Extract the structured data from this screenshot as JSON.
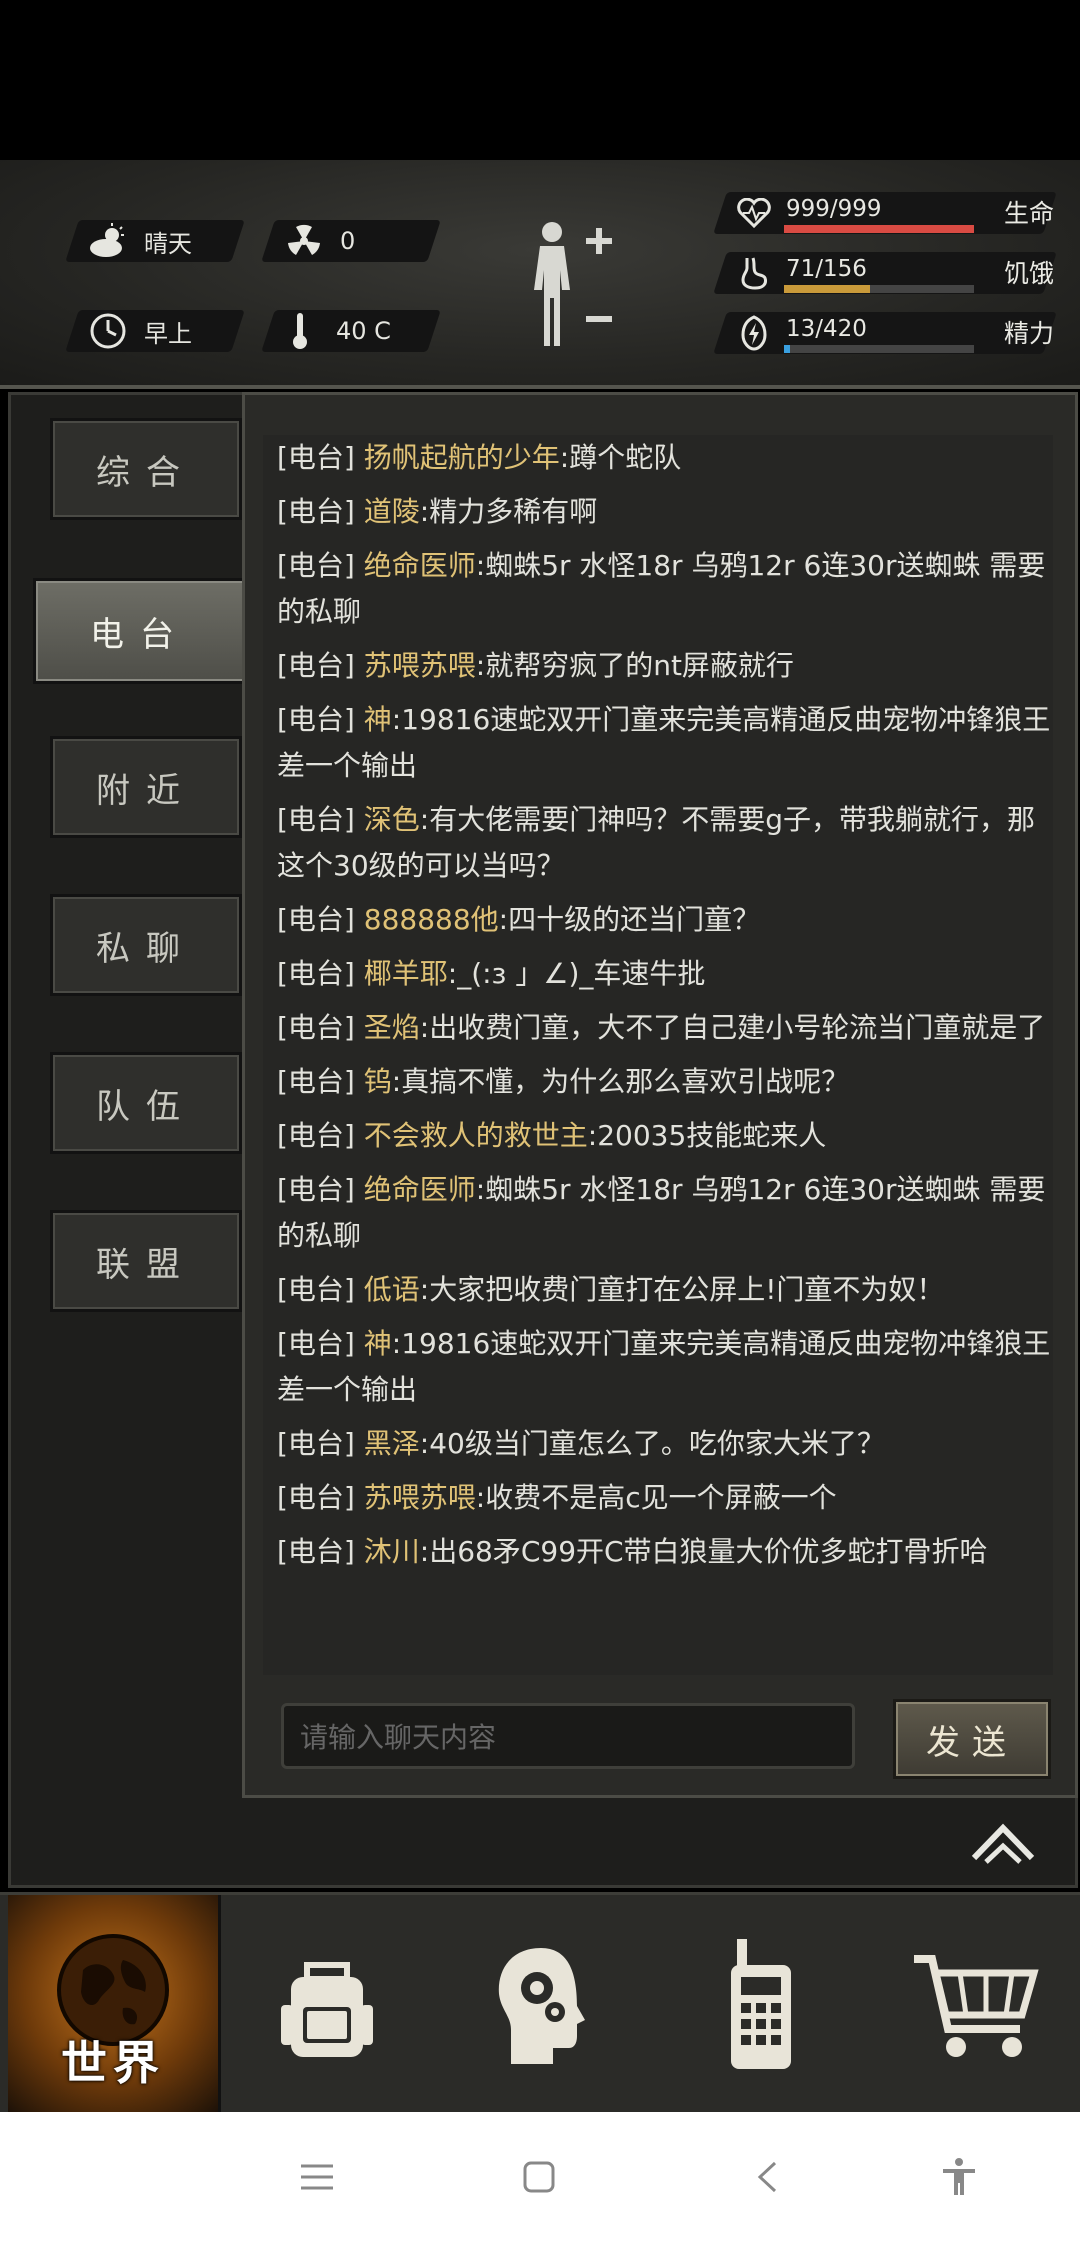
{
  "hud": {
    "weather": "晴天",
    "radiation": "0",
    "time_of_day": "早上",
    "temperature": "40 C",
    "stats": [
      {
        "icon": "heart-icon",
        "value": "999/999",
        "label": "生命",
        "fraction": 1.0,
        "color": "#d94b43"
      },
      {
        "icon": "stomach-icon",
        "value": "71/156",
        "label": "饥饿",
        "fraction": 0.455,
        "color": "#c99a3a"
      },
      {
        "icon": "energy-icon",
        "value": "13/420",
        "label": "精力",
        "fraction": 0.031,
        "color": "#3aa0e0"
      }
    ]
  },
  "tabs": [
    {
      "label": "综合"
    },
    {
      "label": "电台"
    },
    {
      "label": "附近"
    },
    {
      "label": "私聊"
    },
    {
      "label": "队伍"
    },
    {
      "label": "联盟"
    }
  ],
  "messages": [
    {
      "channel": "[电台]",
      "name": "扬帆起航的少年",
      "text": ":蹲个蛇队"
    },
    {
      "channel": "[电台]",
      "name": "道陵",
      "text": ":精力多稀有啊"
    },
    {
      "channel": "[电台]",
      "name": "绝命医师",
      "text": ":蜘蛛5r 水怪18r 乌鸦12r 6连30r送蜘蛛 需要的私聊"
    },
    {
      "channel": "[电台]",
      "name": "苏喂苏喂",
      "text": ":就帮穷疯了的nt屏蔽就行"
    },
    {
      "channel": "[电台]",
      "name": "神",
      "text": ":19816速蛇双开门童来完美高精通反曲宠物冲锋狼王差一个输出"
    },
    {
      "channel": "[电台]",
      "name": "深色",
      "text": ":有大佬需要门神吗？不需要g子，带我躺就行，那这个30级的可以当吗？"
    },
    {
      "channel": "[电台]",
      "name": "888888他",
      "text": ":四十级的还当门童？"
    },
    {
      "channel": "[电台]",
      "name": "椰羊耶",
      "text": ":_(:з 」∠)_车速牛批"
    },
    {
      "channel": "[电台]",
      "name": "圣焰",
      "text": ":出收费门童，大不了自己建小号轮流当门童就是了"
    },
    {
      "channel": "[电台]",
      "name": "钨",
      "text": ":真搞不懂，为什么那么喜欢引战呢？"
    },
    {
      "channel": "[电台]",
      "name": "不会救人的救世主",
      "text": ":20035技能蛇来人"
    },
    {
      "channel": "[电台]",
      "name": "绝命医师",
      "text": ":蜘蛛5r 水怪18r 乌鸦12r 6连30r送蜘蛛 需要的私聊"
    },
    {
      "channel": "[电台]",
      "name": "低语",
      "text": ":大家把收费门童打在公屏上!门童不为奴！"
    },
    {
      "channel": "[电台]",
      "name": "神",
      "text": ":19816速蛇双开门童来完美高精通反曲宠物冲锋狼王差一个输出"
    },
    {
      "channel": "[电台]",
      "name": "黑泽",
      "text": ":40级当门童怎么了。吃你家大米了？"
    },
    {
      "channel": "[电台]",
      "name": "苏喂苏喂",
      "text": ":收费不是高c见一个屏蔽一个"
    },
    {
      "channel": "[电台]",
      "name": "沐川",
      "text": ":出68矛C99开C带白狼量大价优多蛇打骨折哈"
    }
  ],
  "input": {
    "placeholder": "请输入聊天内容"
  },
  "send_label": "发送",
  "bottom_nav": {
    "world_label": "世界"
  }
}
